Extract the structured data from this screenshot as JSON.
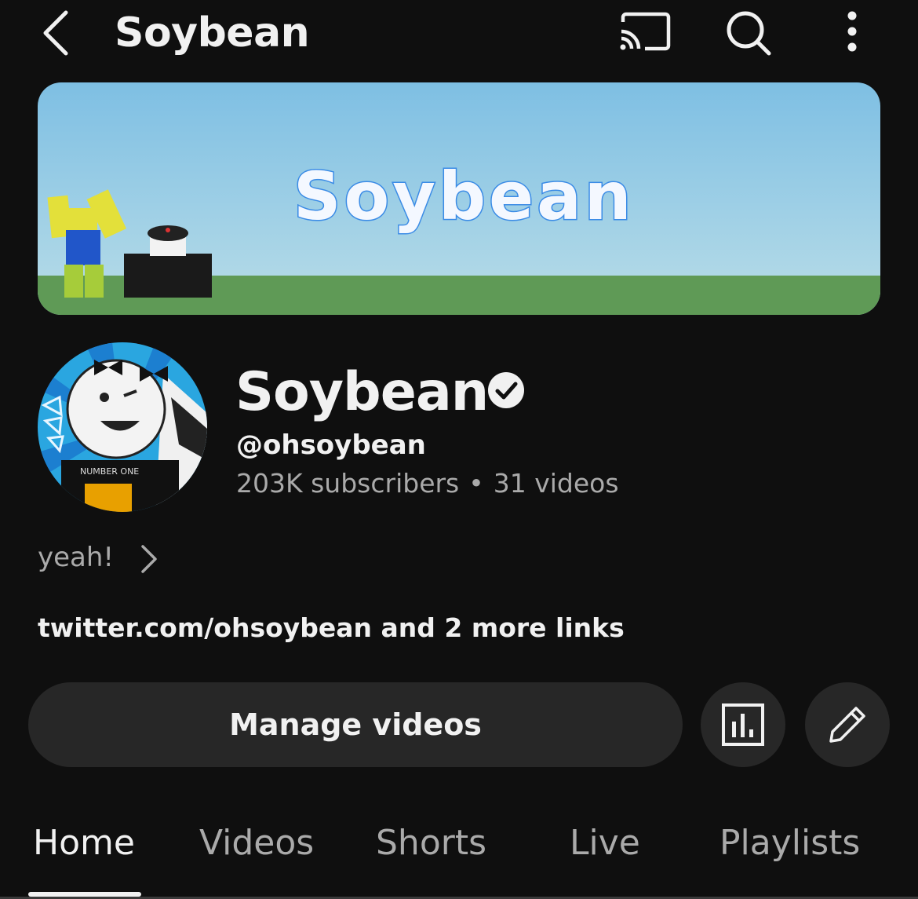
{
  "header": {
    "title": "Soybean",
    "icons": [
      "back-icon",
      "cast-icon",
      "search-icon",
      "more-vertical-icon"
    ]
  },
  "banner": {
    "text": "Soybean",
    "colors": {
      "sky_top": "#7ebfe3",
      "sky_bottom": "#b9dde8",
      "grass": "#5f9a56"
    }
  },
  "channel": {
    "name": "Soybean",
    "verified": true,
    "handle": "@ohsoybean",
    "subscribers": "203K subscribers",
    "separator": "•",
    "videos": "31 videos",
    "description": "yeah!",
    "links": "twitter.com/ohsoybean and 2 more links",
    "avatar_text": "NUMBER ONE"
  },
  "actions": {
    "manage_label": "Manage videos",
    "analytics_icon": "analytics-icon",
    "edit_icon": "pencil-icon"
  },
  "tabs": [
    {
      "label": "Home",
      "active": true
    },
    {
      "label": "Videos",
      "active": false
    },
    {
      "label": "Shorts",
      "active": false
    },
    {
      "label": "Live",
      "active": false
    },
    {
      "label": "Playlists",
      "active": false
    }
  ]
}
